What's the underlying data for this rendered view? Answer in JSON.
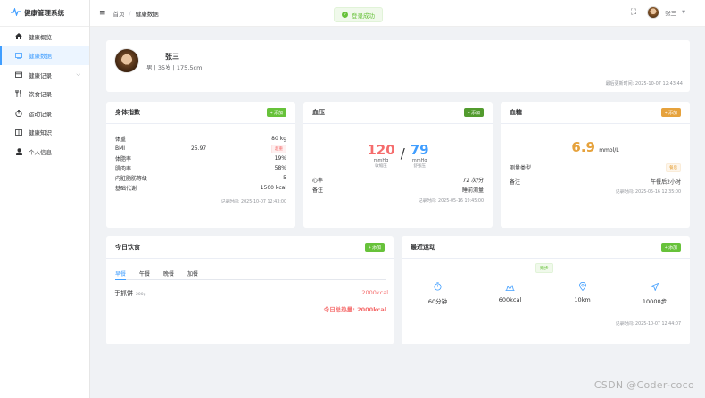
{
  "app": {
    "title": "健康管理系统",
    "logo_icon": "pulse-icon",
    "accent": "#409eff"
  },
  "sidebar": {
    "items": [
      {
        "label": "健康概览",
        "icon": "home-icon"
      },
      {
        "label": "健康数据",
        "icon": "monitor-icon",
        "active": true
      },
      {
        "label": "健康记录",
        "icon": "record-icon",
        "has_submenu": true
      },
      {
        "label": "饮食记录",
        "icon": "fork-knife-icon"
      },
      {
        "label": "运动记录",
        "icon": "timer-icon"
      },
      {
        "label": "健康知识",
        "icon": "book-icon"
      },
      {
        "label": "个人信息",
        "icon": "user-icon"
      }
    ]
  },
  "header": {
    "breadcrumb": [
      "首页",
      "健康数据"
    ],
    "toast": "登录成功",
    "user_name": "张三"
  },
  "profile": {
    "name": "张三",
    "info": "男 | 35岁 | 175.5cm",
    "updated": "最后更新时间: 2025-10-07 12:43:44"
  },
  "body_index": {
    "title": "身体指数",
    "add_label": "+ 添加",
    "rows": [
      {
        "label": "体重",
        "value": "80 kg"
      },
      {
        "label": "BMI",
        "mid": "25.97",
        "badge": "超重"
      },
      {
        "label": "体脂率",
        "value": "19%"
      },
      {
        "label": "肌肉率",
        "value": "58%"
      },
      {
        "label": "内脏脂肪等级",
        "value": "5"
      },
      {
        "label": "基础代谢",
        "value": "1500 kcal"
      }
    ],
    "stamp": "记录时间: 2025-10-07 12:43:00"
  },
  "blood_pressure": {
    "title": "血压",
    "add_label": "+ 添加",
    "systolic": "120",
    "diastolic": "79",
    "unit": "mmHg",
    "systolic_label": "收缩压",
    "diastolic_label": "舒张压",
    "rows": [
      {
        "label": "心率",
        "value": "72 次/分"
      },
      {
        "label": "备注",
        "value": "睡前测量"
      }
    ],
    "stamp": "记录时间: 2025-05-16 19:45:00"
  },
  "blood_sugar": {
    "title": "血糖",
    "add_label": "+ 添加",
    "value": "6.9",
    "unit": "mmol/L",
    "rows": [
      {
        "label": "测量类型",
        "badge": "餐后"
      },
      {
        "label": "备注",
        "value": "午餐后2小时"
      }
    ],
    "stamp": "记录时间: 2025-05-16 12:35:00"
  },
  "diet": {
    "title": "今日饮食",
    "add_label": "+ 添加",
    "tabs": [
      "早餐",
      "午餐",
      "晚餐",
      "加餐"
    ],
    "food_name": "手抓饼",
    "food_weight": "200g",
    "food_kcal": "2000kcal",
    "total": "今日总热量: 2000kcal"
  },
  "exercise": {
    "title": "最近运动",
    "add_label": "+ 添加",
    "type": "跑步",
    "items": [
      {
        "icon": "stopwatch-icon",
        "value": "60分钟"
      },
      {
        "icon": "flame-icon",
        "value": "600kcal"
      },
      {
        "icon": "location-pin-icon",
        "value": "10km"
      },
      {
        "icon": "navigation-arrow-icon",
        "value": "10000步"
      }
    ],
    "stamp": "记录时间: 2025-10-07 12:44:07"
  },
  "watermark": "CSDN @Coder-coco"
}
